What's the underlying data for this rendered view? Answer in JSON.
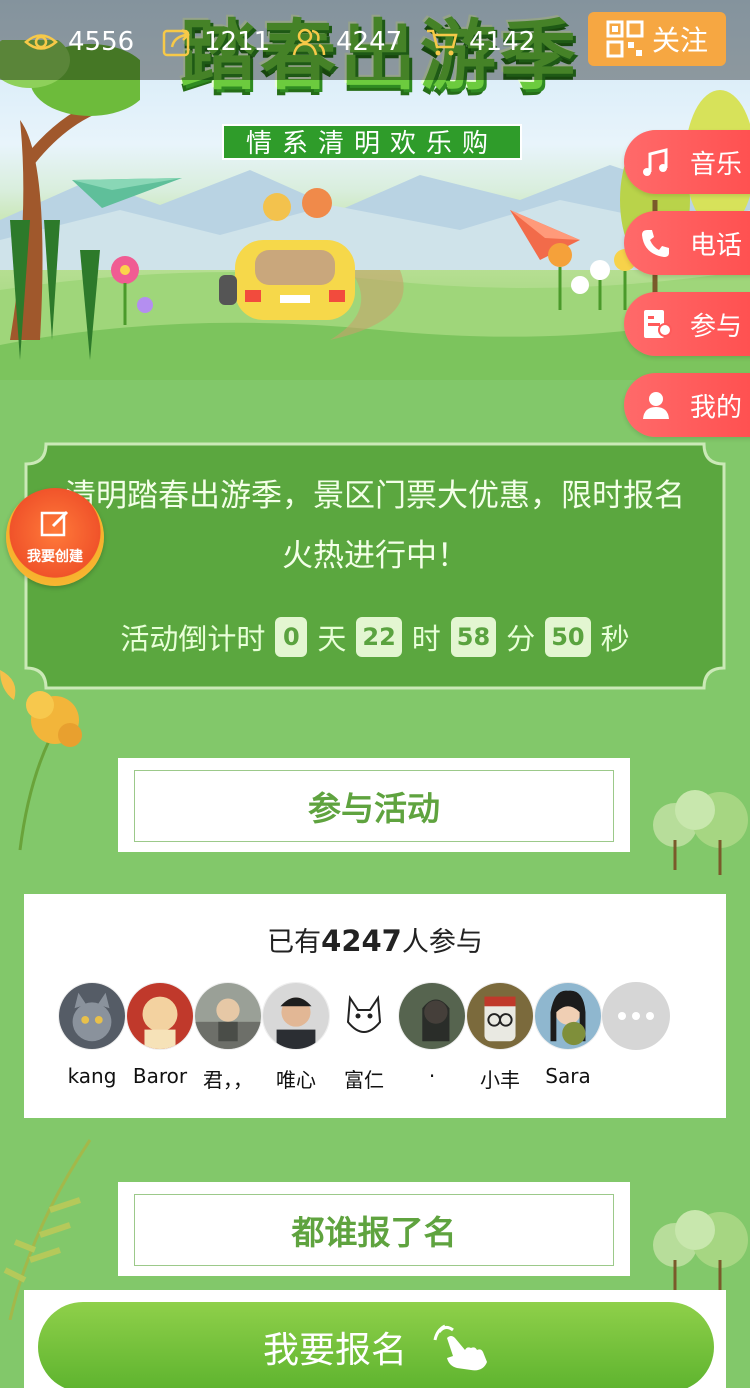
{
  "banner": {
    "title": "踏春出游季",
    "subtitle": "情系清明欢乐购"
  },
  "stats": {
    "views": "4556",
    "shares": "1211",
    "participants": "4247",
    "orders": "4142"
  },
  "follow": {
    "label": "关注"
  },
  "side_tabs": [
    {
      "label": "音乐",
      "icon": "music-icon"
    },
    {
      "label": "电话",
      "icon": "phone-icon"
    },
    {
      "label": "参与",
      "icon": "join-icon"
    },
    {
      "label": "我的",
      "icon": "user-icon"
    }
  ],
  "activity": {
    "description": "清明踏春出游季，景区门票大优惠，限时报名火热进行中！",
    "countdown_label": "活动倒计时",
    "days": "0",
    "days_unit": "天",
    "hours": "22",
    "hours_unit": "时",
    "minutes": "58",
    "minutes_unit": "分",
    "seconds": "50",
    "seconds_unit": "秒"
  },
  "create_badge": {
    "label": "我要创建"
  },
  "join_section": {
    "title": "参与活动"
  },
  "participants": {
    "prefix": "已有",
    "count": "4247",
    "suffix": "人参与",
    "users": [
      {
        "name": "kang",
        "color": "#5b6470"
      },
      {
        "name": "Baror",
        "color": "#c0392b"
      },
      {
        "name": "君，，",
        "color": "#8a8f86"
      },
      {
        "name": "唯心",
        "color": "#3b3f45"
      },
      {
        "name": "富仁",
        "color": "#f2f2f2"
      },
      {
        "name": "·",
        "color": "#4d5a4a"
      },
      {
        "name": "小丰",
        "color": "#8d6b3a"
      },
      {
        "name": "Sara",
        "color": "#6f9bb8"
      }
    ]
  },
  "signed_section": {
    "title": "都谁报了名"
  },
  "signup": {
    "label": "我要报名"
  }
}
